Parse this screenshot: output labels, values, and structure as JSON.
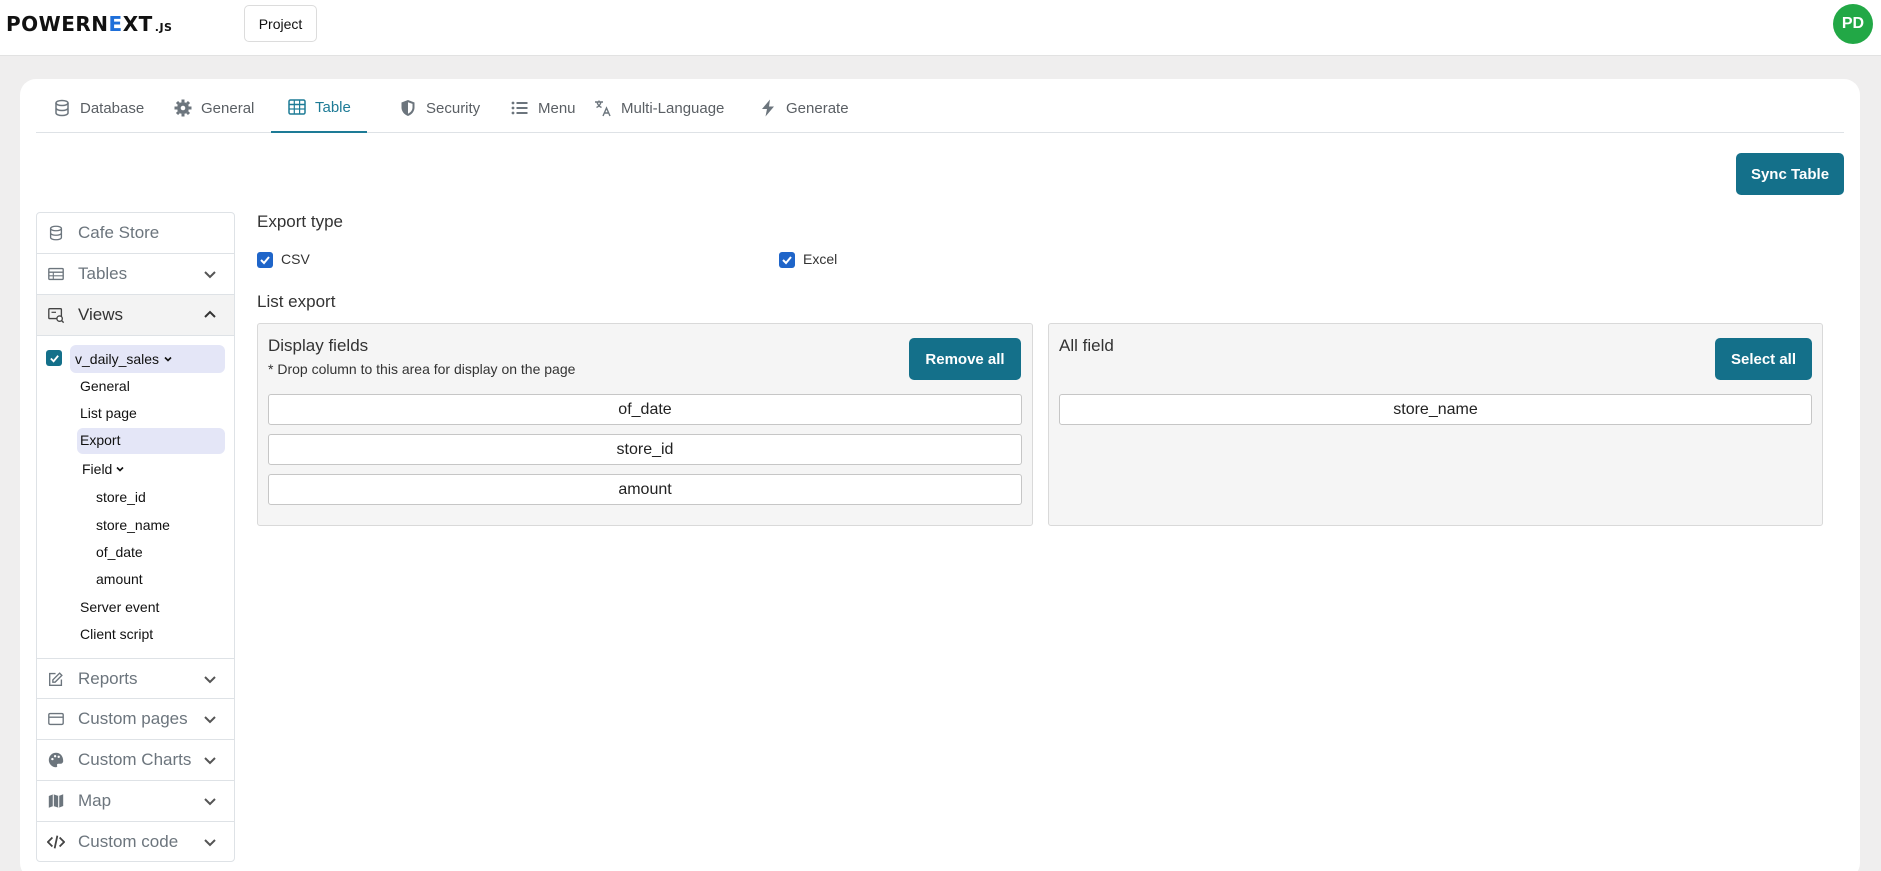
{
  "header": {
    "logo_part1": "POWERN",
    "logo_accent": "E",
    "logo_part2": "XT",
    "logo_suffix": ".JS",
    "project_label": "Project",
    "avatar_initials": "PD"
  },
  "tabs": [
    {
      "label": "Database",
      "icon": "database-icon"
    },
    {
      "label": "General",
      "icon": "gear-icon"
    },
    {
      "label": "Table",
      "icon": "table-icon",
      "active": true
    },
    {
      "label": "Security",
      "icon": "shield-icon"
    },
    {
      "label": "Menu",
      "icon": "list-icon"
    },
    {
      "label": "Multi-Language",
      "icon": "translate-icon"
    },
    {
      "label": "Generate",
      "icon": "bolt-icon"
    }
  ],
  "toolbar": {
    "sync_label": "Sync Table"
  },
  "sidebar": {
    "items": [
      {
        "label": "Cafe Store",
        "icon": "database-icon"
      },
      {
        "label": "Tables",
        "icon": "table-icon"
      },
      {
        "label": "Views",
        "icon": "view-icon",
        "expanded": true
      },
      {
        "label": "Reports",
        "icon": "edit-icon"
      },
      {
        "label": "Custom pages",
        "icon": "card-icon"
      },
      {
        "label": "Custom Charts",
        "icon": "palette-icon"
      },
      {
        "label": "Map",
        "icon": "map-icon"
      },
      {
        "label": "Custom code",
        "icon": "code-icon"
      }
    ],
    "view_name": "v_daily_sales",
    "view_children": [
      "General",
      "List page",
      "Export"
    ],
    "field_label": "Field",
    "fields": [
      "store_id",
      "store_name",
      "of_date",
      "amount"
    ],
    "extra_children": [
      "Server event",
      "Client script"
    ],
    "selected": "Export"
  },
  "export": {
    "type_label": "Export type",
    "options": [
      {
        "label": "CSV",
        "checked": true
      },
      {
        "label": "Excel",
        "checked": true
      }
    ],
    "list_label": "List export",
    "display_panel": {
      "title": "Display fields",
      "note": "* Drop column to this area for display on the page",
      "button": "Remove all",
      "fields": [
        "of_date",
        "store_id",
        "amount"
      ]
    },
    "all_panel": {
      "title": "All field",
      "button": "Select all",
      "fields": [
        "store_name"
      ]
    }
  },
  "colors": {
    "accent": "#14708a",
    "avatar": "#22a846",
    "check": "#1f65c9"
  }
}
